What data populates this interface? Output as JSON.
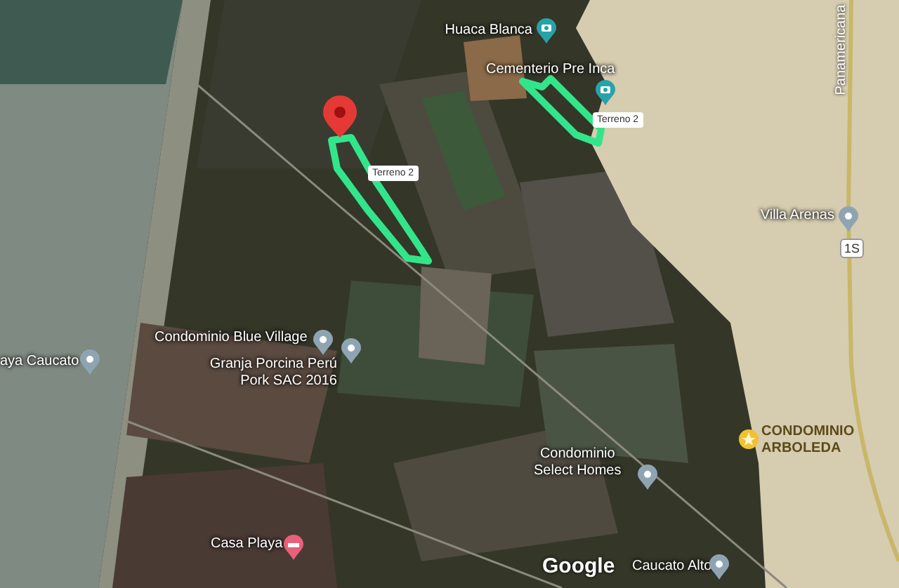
{
  "map": {
    "places": [
      {
        "label": "Huaca Blanca",
        "kind": "camera"
      },
      {
        "label": "Cementerio Pre Inca",
        "kind": "camera"
      },
      {
        "label": "Terreno 2",
        "kind": "tag"
      },
      {
        "label": "Terreno 2",
        "kind": "tag"
      },
      {
        "label": "Villa Arenas",
        "kind": "pin"
      },
      {
        "label": "aya Caucato",
        "kind": "pin"
      },
      {
        "label": "Condominio Blue Village",
        "kind": "pin"
      },
      {
        "label": "Granja Porcina Perú\nPork SAC 2016",
        "kind": "pin"
      },
      {
        "label": "CONDOMINIO\nARBOLEDA",
        "kind": "star"
      },
      {
        "label": "Condominio\nSelect Homes",
        "kind": "pin"
      },
      {
        "label": "Casa Playa",
        "kind": "hotel"
      },
      {
        "label": "Caucato Alto",
        "kind": "pin"
      }
    ],
    "road_name": "Panamericana",
    "road_shield": "1S",
    "logo": "Google"
  }
}
